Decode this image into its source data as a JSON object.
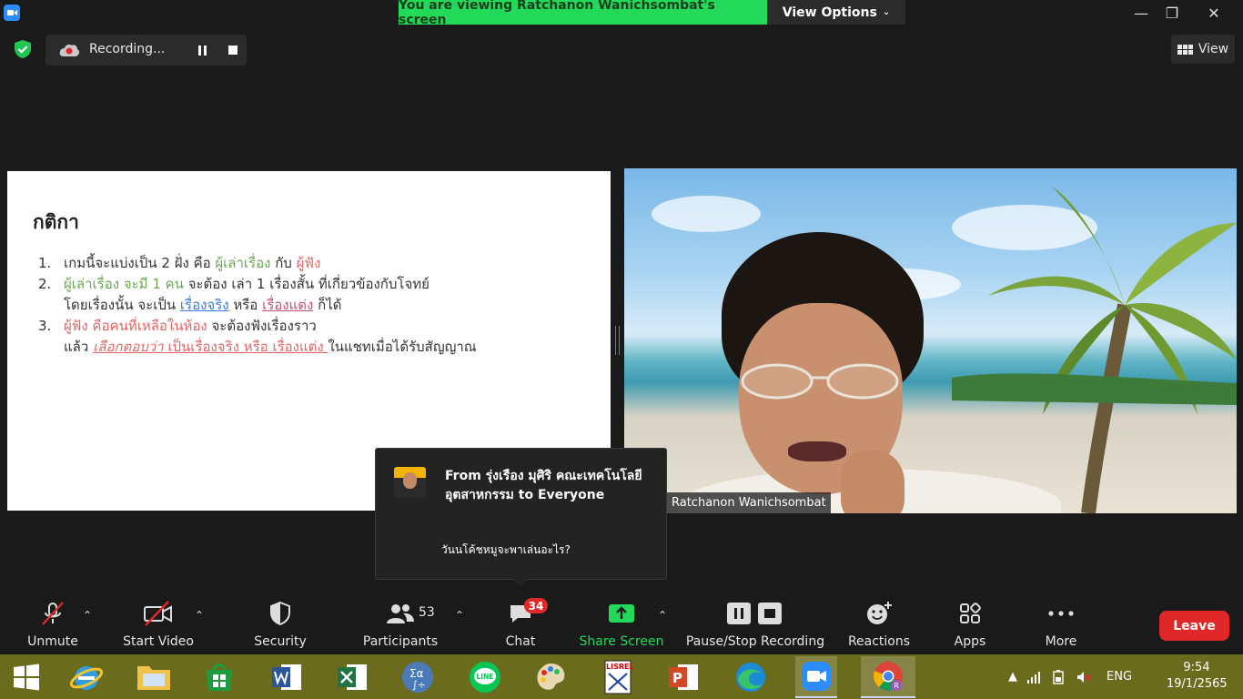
{
  "titlebar": {
    "banner": "You are viewing Ratchanon Wanichsombat's screen",
    "view_options": "View Options"
  },
  "recording": {
    "label": "Recording..."
  },
  "view_button": {
    "label": "View"
  },
  "slide": {
    "title": "กติกา",
    "items": [
      {
        "num": "1.",
        "line1_a": "เกมนี้จะแบ่งเป็น 2 ฝั่ง คือ ",
        "line1_b": "ผู้เล่าเรื่อง",
        "line1_c": " กับ ",
        "line1_d": "ผู้ฟัง"
      },
      {
        "num": "2.",
        "line1_a": "ผู้เล่าเรื่อง จะมี 1 คน",
        "line1_b": " จะต้อง เล่า 1 เรื่องสั้น ที่เกี่ยวข้องกับโจทย์",
        "line2_a": "โดยเรื่องนั้น จะเป็น ",
        "line2_b": "เรื่องจริง",
        "line2_c": " หรือ ",
        "line2_d": "เรื่องแต่ง",
        "line2_e": " ก็ได้"
      },
      {
        "num": "3.",
        "line1_a": "ผู้ฟัง คือคนที่เหลือในห้อง",
        "line1_b": " จะต้องฟังเรื่องราว",
        "line2_a": "แล้ว ",
        "line2_b": "เลือกตอบว่า",
        "line2_c": " เป็นเรื่องจริง หรือ เรื่องแต่ง ",
        "line2_d": "ในแชทเมื่อได้รับสัญญาณ"
      }
    ]
  },
  "video": {
    "name": "Ratchanon Wanichsombat"
  },
  "chat_popup": {
    "from": "From รุ่งเรือง มุศิริ คณะเทคโนโลยีอุตสาหกรรม to Everyone",
    "message": "วันนโค้ชหมูจะพาเล่นอะไร?"
  },
  "toolbar": {
    "unmute": "Unmute",
    "start_video": "Start Video",
    "security": "Security",
    "participants": "Participants",
    "participants_count": "53",
    "chat": "Chat",
    "chat_badge": "34",
    "share_screen": "Share Screen",
    "pause_stop": "Pause/Stop Recording",
    "reactions": "Reactions",
    "apps": "Apps",
    "more": "More",
    "leave": "Leave"
  },
  "taskbar": {
    "lang": "ENG",
    "time": "9:54",
    "date": "19/1/2565"
  },
  "colors": {
    "banner_green": "#23d959",
    "leave_red": "#e02828",
    "taskbar": "#6b6b1e"
  }
}
